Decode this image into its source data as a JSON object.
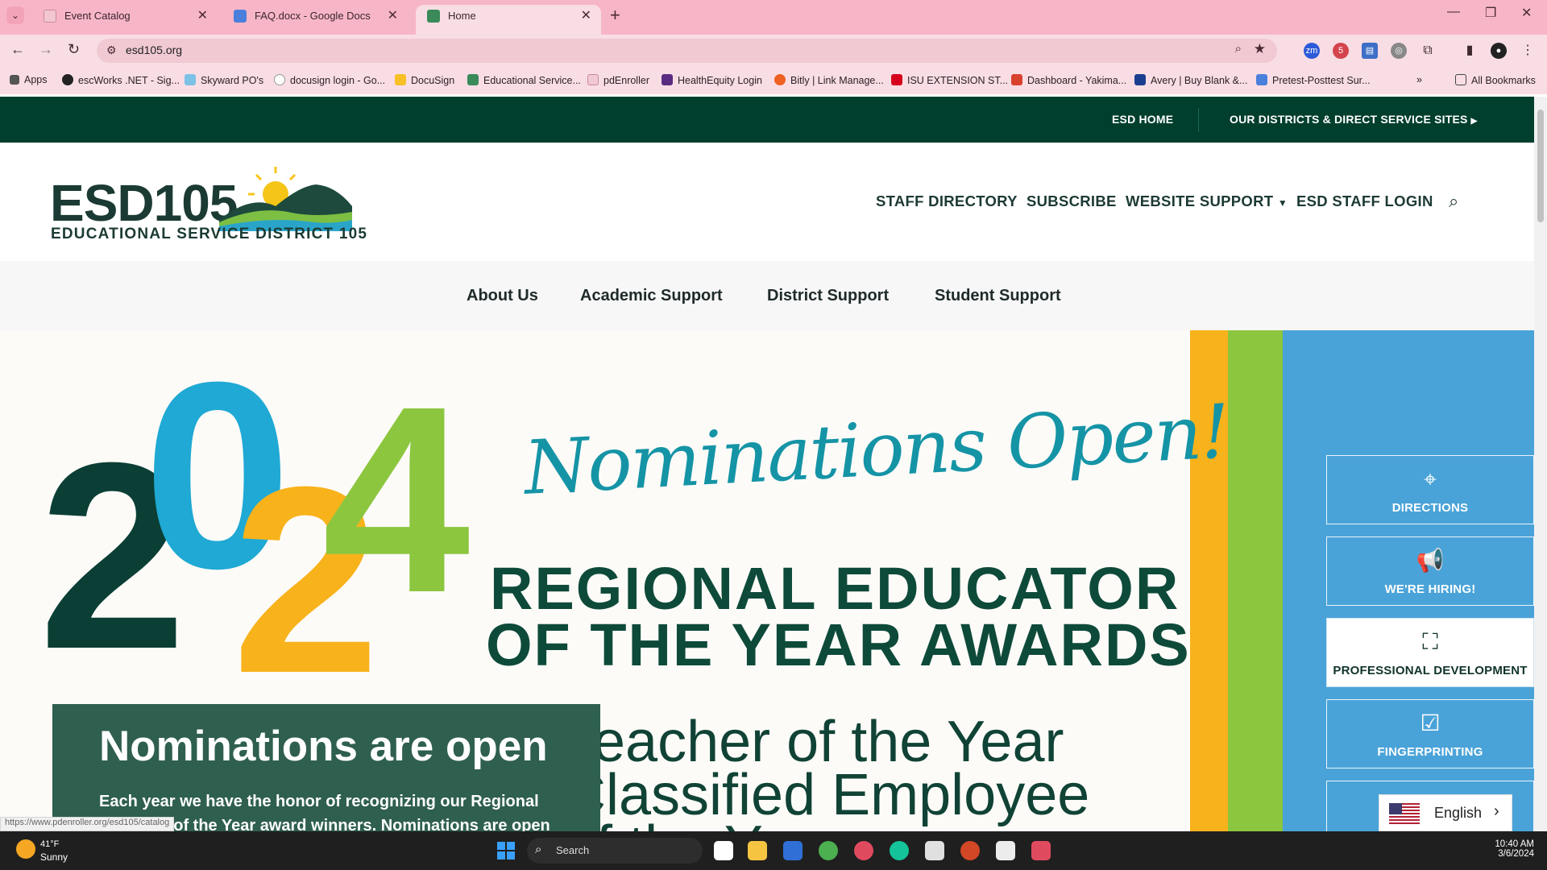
{
  "browser": {
    "tabs": [
      {
        "title": "Event Catalog",
        "active": false
      },
      {
        "title": "FAQ.docx - Google Docs",
        "active": false
      },
      {
        "title": "Home",
        "active": true
      }
    ],
    "url": "esd105.org",
    "bookmarks": [
      "Apps",
      "escWorks .NET - Sig...",
      "Skyward PO's",
      "docusign login - Go...",
      "DocuSign",
      "Educational Service...",
      "pdEnroller",
      "HealthEquity Login",
      "Bitly | Link Manage...",
      "ISU EXTENSION ST...",
      "Dashboard - Yakima...",
      "Avery | Buy Blank &...",
      "Pretest-Posttest Sur...",
      "All Bookmarks"
    ],
    "status_url": "https://www.pdenroller.org/esd105/catalog"
  },
  "site": {
    "top_links": [
      "ESD HOME",
      "OUR DISTRICTS & DIRECT SERVICE SITES"
    ],
    "logo": {
      "name": "ESD105",
      "subtitle": "EDUCATIONAL SERVICE DISTRICT 105"
    },
    "header_nav": [
      "STAFF DIRECTORY",
      "SUBSCRIBE",
      "WEBSITE SUPPORT",
      "ESD STAFF LOGIN"
    ],
    "main_nav": [
      "About Us",
      "Academic Support",
      "District Support",
      "Student Support"
    ],
    "hero": {
      "year_digits": [
        "2",
        "0",
        "2",
        "4"
      ],
      "script_text": "Nominations Open!",
      "award_line1": "REGIONAL EDUCATOR",
      "award_line2": "OF THE YEAR AWARDS",
      "bullets": [
        "Teacher of the Year",
        "Classified Employee",
        "of the Year"
      ],
      "overlay_title": "Nominations are open",
      "overlay_text": "Each year we have the honor of recognizing our Regional Educator of the Year award winners. Nominations are open"
    },
    "quick_links": [
      "DIRECTIONS",
      "WE'RE HIRING!",
      "PROFESSIONAL DEVELOPMENT",
      "FINGERPRINTING"
    ],
    "language": "English"
  },
  "taskbar": {
    "temp": "41°F",
    "weather": "Sunny",
    "search": "Search",
    "time": "10:40 AM",
    "date": "3/6/2024"
  }
}
